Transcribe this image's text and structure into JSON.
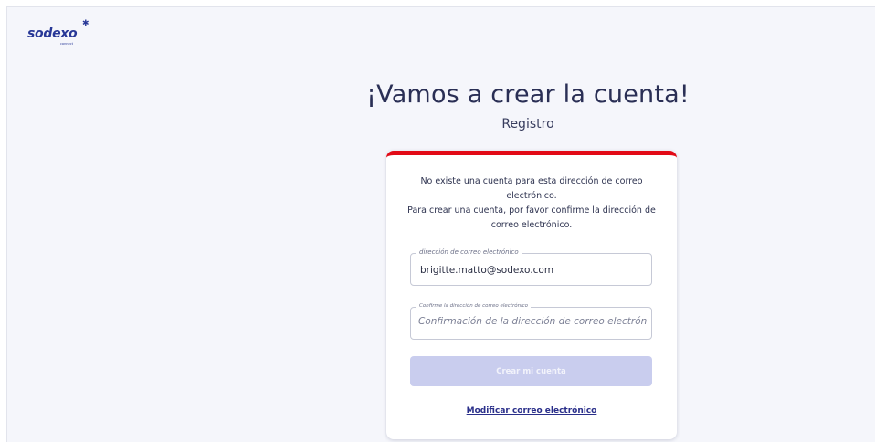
{
  "brand": {
    "logo_text": "sodexo",
    "logo_star": "✱",
    "logo_sub": "connect"
  },
  "header": {
    "title": "¡Vamos a crear la cuenta!",
    "subtitle": "Registro"
  },
  "card": {
    "message_line1": "No existe una cuenta para esta dirección de correo electrónico.",
    "message_line2": "Para crear una cuenta, por favor confirme la dirección de correo electrónico.",
    "email_field": {
      "label": "dirección de correo electrónico",
      "value": "brigitte.matto@sodexo.com"
    },
    "confirm_field": {
      "label": "Confirme la dirección de correo electrónico",
      "placeholder": "Confirmación de la dirección de correo electrónico",
      "value": ""
    },
    "create_button_label": "Crear mi cuenta",
    "modify_link_label": "Modificar correo electrónico"
  },
  "colors": {
    "accent_red": "#e20a16",
    "brand_blue": "#283897",
    "button_disabled": "#c9cdee"
  }
}
